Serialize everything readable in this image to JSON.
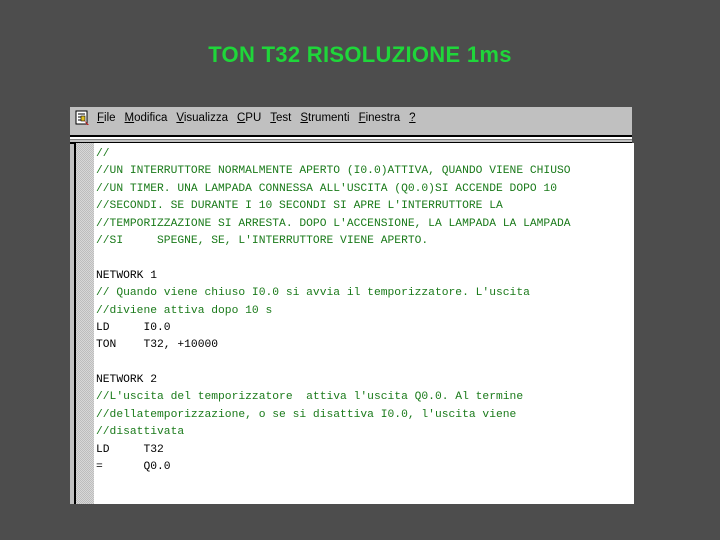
{
  "slide": {
    "title": "TON T32 RISOLUZIONE 1ms"
  },
  "colors": {
    "background": "#4d4d4d",
    "title": "#1fd63a",
    "comment": "#1a7a1a",
    "instruction": "#000000",
    "window_chrome": "#c0c0c0"
  },
  "window": {
    "app_icon": "program-editor-icon",
    "menu": [
      {
        "label": "File",
        "accel": "F",
        "rest": "ile"
      },
      {
        "label": "Modifica",
        "accel": "M",
        "rest": "odifica"
      },
      {
        "label": "Visualizza",
        "accel": "V",
        "rest": "isualizza"
      },
      {
        "label": "CPU",
        "accel": "C",
        "rest": "PU"
      },
      {
        "label": "Test",
        "accel": "T",
        "rest": "est"
      },
      {
        "label": "Strumenti",
        "accel": "S",
        "rest": "trumenti"
      },
      {
        "label": "Finestra",
        "accel": "F",
        "rest": "inestra"
      },
      {
        "label": "?",
        "accel": "?",
        "rest": ""
      }
    ]
  },
  "code": {
    "lines": [
      {
        "type": "comment",
        "text": "//"
      },
      {
        "type": "comment",
        "text": "//UN INTERRUTTORE NORMALMENTE APERTO (I0.0)ATTIVA, QUANDO VIENE CHIUSO"
      },
      {
        "type": "comment",
        "text": "//UN TIMER. UNA LAMPADA CONNESSA ALL'USCITA (Q0.0)SI ACCENDE DOPO 10"
      },
      {
        "type": "comment",
        "text": "//SECONDI. SE DURANTE I 10 SECONDI SI APRE L'INTERRUTTORE LA"
      },
      {
        "type": "comment",
        "text": "//TEMPORIZZAZIONE SI ARRESTA. DOPO L'ACCENSIONE, LA LAMPADA LA LAMPADA"
      },
      {
        "type": "comment",
        "text": "//SI     SPEGNE, SE, L'INTERRUTTORE VIENE APERTO."
      },
      {
        "type": "blank",
        "text": ""
      },
      {
        "type": "instr",
        "text": "NETWORK 1"
      },
      {
        "type": "comment",
        "text": "// Quando viene chiuso I0.0 si avvia il temporizzatore. L'uscita"
      },
      {
        "type": "comment",
        "text": "//diviene attiva dopo 10 s"
      },
      {
        "type": "instr",
        "text": "LD     I0.0"
      },
      {
        "type": "instr",
        "text": "TON    T32, +10000"
      },
      {
        "type": "blank",
        "text": ""
      },
      {
        "type": "instr",
        "text": "NETWORK 2"
      },
      {
        "type": "comment",
        "text": "//L'uscita del temporizzatore  attiva l'uscita Q0.0. Al termine"
      },
      {
        "type": "comment",
        "text": "//dellatemporizzazione, o se si disattiva I0.0, l'uscita viene"
      },
      {
        "type": "comment",
        "text": "//disattivata"
      },
      {
        "type": "instr",
        "text": "LD     T32"
      },
      {
        "type": "instr",
        "text": "=      Q0.0"
      }
    ]
  }
}
